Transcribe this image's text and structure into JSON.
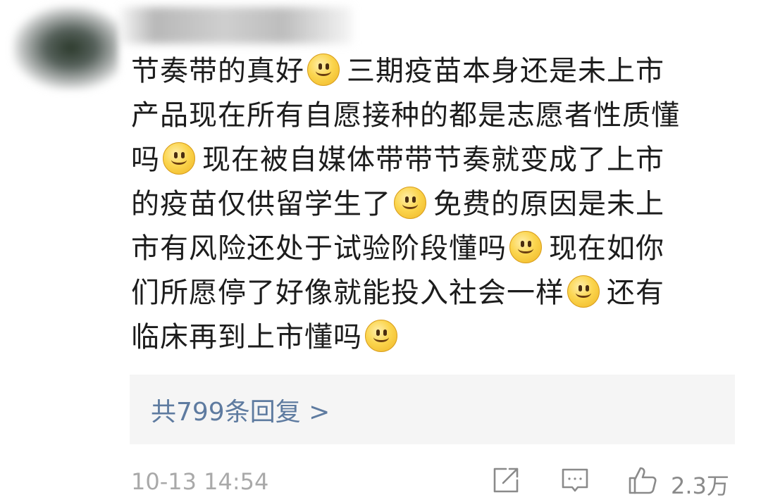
{
  "comment": {
    "segments": [
      {
        "type": "text",
        "text": "节奏带的真好"
      },
      {
        "type": "emoji",
        "name": "smile-emoji-icon"
      },
      {
        "type": "text",
        "text": "三期疫苗本身还是未上市产品现在所有自愿接种的都是志愿者性质懂吗"
      },
      {
        "type": "emoji",
        "name": "smile-emoji-icon"
      },
      {
        "type": "text",
        "text": "现在被自媒体带带节奏就变成了上市的疫苗仅供留学生了"
      },
      {
        "type": "emoji",
        "name": "smile-emoji-icon"
      },
      {
        "type": "text",
        "text": "免费的原因是未上市有风险还处于试验阶段懂吗"
      },
      {
        "type": "emoji",
        "name": "smile-emoji-icon"
      },
      {
        "type": "text",
        "text": "现在如你们所愿停了好像就能投入社会一样"
      },
      {
        "type": "emoji",
        "name": "smile-emoji-icon"
      },
      {
        "type": "text",
        "text": "还有临床再到上市懂吗"
      },
      {
        "type": "emoji",
        "name": "smile-emoji-icon"
      }
    ]
  },
  "replies": {
    "label": "共799条回复 >"
  },
  "footer": {
    "timestamp": "10-13 14:54",
    "like_count": "2.3万",
    "icons": [
      "share-icon",
      "comment-icon",
      "like-icon"
    ]
  },
  "colors": {
    "link": "#5e7ba0",
    "text": "#1c1c1c",
    "meta": "#a9a9a9",
    "reply_bg": "#f5f5f5"
  }
}
